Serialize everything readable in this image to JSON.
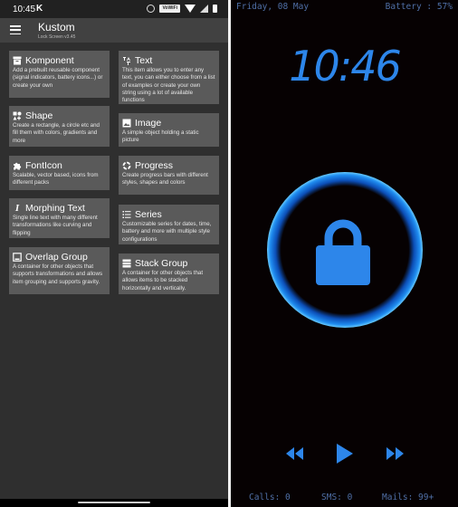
{
  "status_bar": {
    "time": "10:45",
    "notification_glyph": "K",
    "icons": [
      "alarm-icon",
      "volte-icon",
      "wifi-icon",
      "signal-icon",
      "battery-icon"
    ],
    "volte_label": "VoWiFi"
  },
  "app_bar": {
    "menu_icon": "hamburger-icon",
    "title": "Kustom",
    "subtitle": "Lock Screen v3.45"
  },
  "tiles": [
    {
      "id": "komponent",
      "icon": "archive-box-icon",
      "title": "Komponent",
      "description": "Add a prebuilt reusable component (signal indicators, battery icons...) or create your own"
    },
    {
      "id": "text",
      "icon": "text-format-icon",
      "title": "Text",
      "description": "This item allows you to enter any text, you can either choose from a list of examples or create your own string using a lot of available functions"
    },
    {
      "id": "shape",
      "icon": "shapes-icon",
      "title": "Shape",
      "description": "Create a rectangle, a circle etc and fill them with colors, gradients and more"
    },
    {
      "id": "image",
      "icon": "image-icon",
      "title": "Image",
      "description": "A simple object holding a static picture"
    },
    {
      "id": "fonticon",
      "icon": "puzzle-icon",
      "title": "FontIcon",
      "description": "Scalable, vector based, icons from different packs"
    },
    {
      "id": "progress",
      "icon": "progress-ring-icon",
      "title": "Progress",
      "description": "Create progress bars with different styles, shapes and colors"
    },
    {
      "id": "morphing-text",
      "icon": "italic-text-icon",
      "title": "Morphing Text",
      "description": "Single line text with many different transformations like curving and flipping"
    },
    {
      "id": "series",
      "icon": "list-icon",
      "title": "Series",
      "description": "Customizable series for dates, time, battery and more with multiple style configurations"
    },
    {
      "id": "overlap-group",
      "icon": "overlap-group-icon",
      "title": "Overlap Group",
      "description": "A container for other objects that supports transformations and allows item grouping and supports gravity."
    },
    {
      "id": "stack-group",
      "icon": "stack-group-icon",
      "title": "Stack Group",
      "description": "A container for other objects that allows items to be stacked horizontally and vertically."
    }
  ],
  "lock_screen": {
    "date": "Friday, 08 May",
    "battery": "Battery : 57%",
    "clock": "10:46",
    "lock_icon": "padlock-icon",
    "media": {
      "previous_icon": "rewind-icon",
      "play_icon": "play-icon",
      "next_icon": "fast-forward-icon"
    },
    "calls": "Calls: 0",
    "sms": "SMS: 0",
    "mails": "Mails: 99+",
    "colors": {
      "accent": "#2d86ea",
      "info_text": "#4f6fa6",
      "background": "#060102"
    }
  }
}
